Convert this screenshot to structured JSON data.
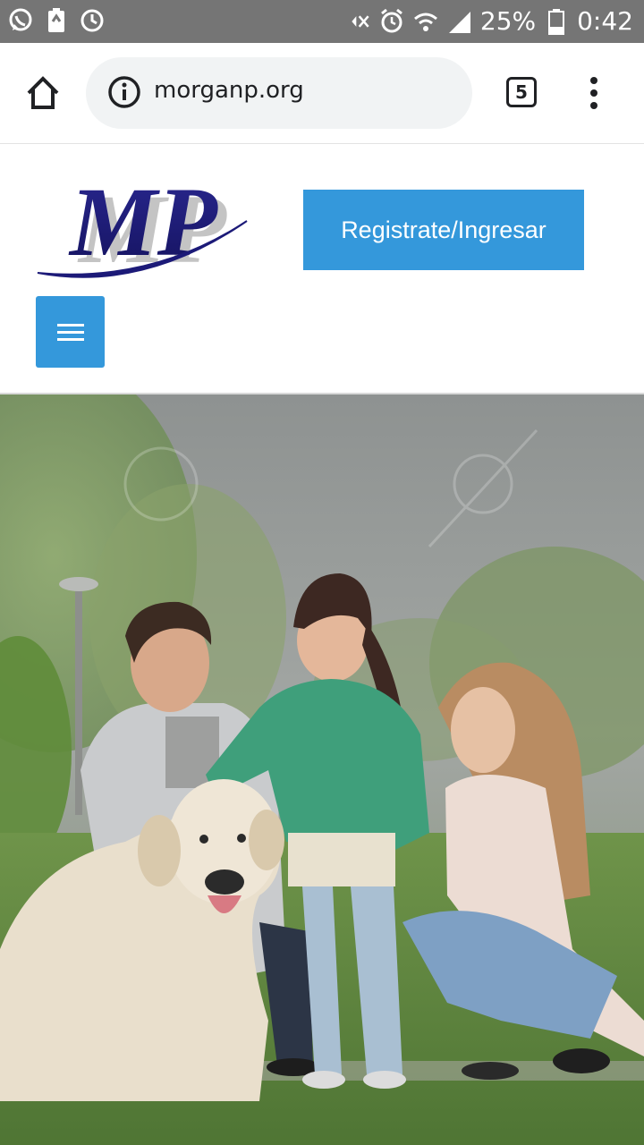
{
  "status_bar": {
    "battery_percent": "25%",
    "time": "0:42",
    "left_icons": [
      "whatsapp-icon",
      "battery-saver-icon",
      "sync-icon"
    ],
    "right_icons": [
      "mute-icon",
      "alarm-icon",
      "wifi-icon",
      "signal-icon",
      "battery-icon"
    ]
  },
  "browser": {
    "url": "morganp.org",
    "tab_count": "5"
  },
  "site": {
    "logo_text": "MP",
    "register_button": "Registrate/Ingresar"
  },
  "colors": {
    "accent": "#3498db",
    "status_bar": "#757575",
    "logo_navy": "#1c1a78"
  }
}
